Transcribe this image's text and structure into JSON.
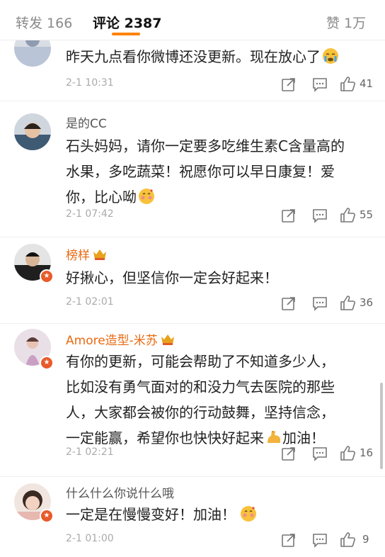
{
  "tabs": {
    "repost": "转发 166",
    "comments": "评论 2387",
    "likes": "赞 1万"
  },
  "colors": {
    "accent": "#ff8200",
    "vip_name": "#e86a12",
    "badge": "#e85a2a"
  },
  "comments": [
    {
      "username": "",
      "text_lines": [
        "昨天九点看你微博还没更新。现在放心了"
      ],
      "emoji": "crying-face-icon",
      "time": "2-1 10:31",
      "likes": "41"
    },
    {
      "username": "是的CC",
      "text_lines": [
        "石头妈妈，请你一定要多吃维生素C含量高的",
        "水果，多吃蔬菜！祝愿你可以早日康复！爱",
        "你，比心呦"
      ],
      "emoji": "blush-heart-face-icon",
      "time": "2-1 07:42",
      "likes": "55"
    },
    {
      "username": "榜样",
      "text_lines": [
        "好揪心，但坚信你一定会好起来！"
      ],
      "time": "2-1 02:01",
      "likes": "36"
    },
    {
      "username": "Amore造型-米苏",
      "text_lines": [
        "有你的更新，可能会帮助了不知道多少人，",
        "比如没有勇气面对的和没力气去医院的那些",
        "人，大家都会被你的行动鼓舞，坚持信念，",
        "一定能赢，希望你也快快好起来",
        "加油！"
      ],
      "emoji": "flexed-biceps-icon",
      "time": "2-1 02:21",
      "likes": "16"
    },
    {
      "username": "什么什么你说什么哦",
      "text_lines": [
        "一定是在慢慢变好！加油！"
      ],
      "emoji": "blush-heart-face-icon",
      "time": "2-1 01:00",
      "likes": "9"
    }
  ]
}
